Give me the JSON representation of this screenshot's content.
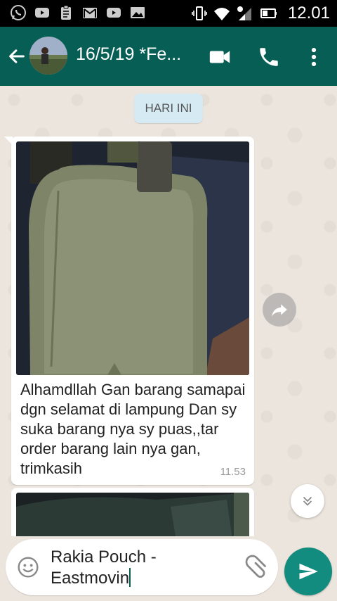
{
  "status_bar": {
    "left_icons": [
      "whatsapp-icon",
      "youtube-icon",
      "clipboard-icon",
      "gmail-icon",
      "youtube-icon",
      "gallery-icon"
    ],
    "right_icons": [
      "vibrate-icon",
      "wifi-icon",
      "signal-icon",
      "battery-icon"
    ],
    "time": "12.01"
  },
  "toolbar": {
    "title": "16/5/19 *Fe...",
    "back_icon": "arrow-left-icon",
    "video_icon": "video-call-icon",
    "call_icon": "phone-icon",
    "menu_icon": "more-vert-icon",
    "color": "#075E54"
  },
  "chat": {
    "date_chip": "HARI INI",
    "messages": [
      {
        "type": "image",
        "caption": "Alhamdllah Gan barang samapai dgn selamat di lampung Dan sy suka barang nya sy puas,,tar order barang lain nya gan, trimkasih",
        "time": "11.53"
      },
      {
        "type": "image",
        "caption": "",
        "time": ""
      }
    ],
    "forward_icon": "share-arrow-icon",
    "scroll_icon": "double-chevron-down-icon"
  },
  "composer": {
    "value": "Rakia Pouch - Eastmovin",
    "emoji_icon": "emoji-icon",
    "attach_icon": "paperclip-icon",
    "send_icon": "send-icon",
    "accent": "#128C7E"
  }
}
